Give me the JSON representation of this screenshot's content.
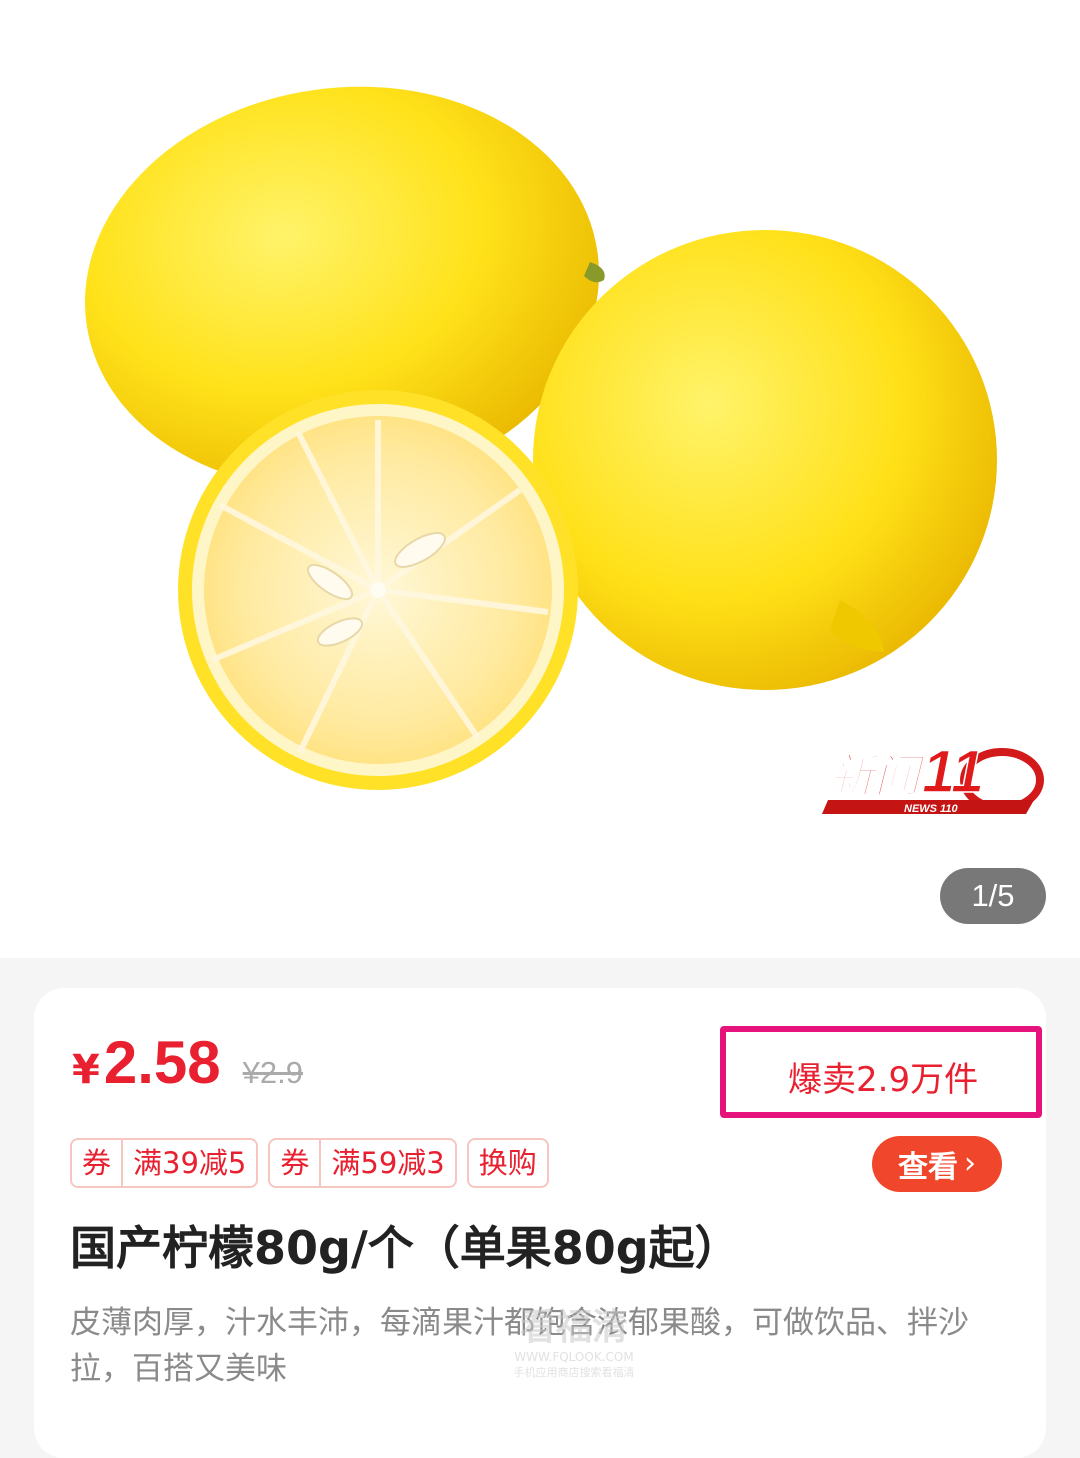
{
  "gallery": {
    "pager": "1/5",
    "logo": {
      "brand": "新闻110",
      "sub": "NEWS 110"
    }
  },
  "product": {
    "currency": "¥",
    "price": "2.58",
    "original_price": "¥2.9",
    "sold": "爆卖2.9万件",
    "tags": [
      {
        "segments": [
          "券",
          "满39减5"
        ]
      },
      {
        "segments": [
          "券",
          "满59减3"
        ]
      },
      {
        "segments": [
          "换购"
        ]
      }
    ],
    "view_button": "查看",
    "title": "国产柠檬80g/个（单果80g起）",
    "description": "皮薄肉厚，汁水丰沛，每滴果汁都饱含浓郁果酸，可做饮品、拌沙拉，百搭又美味"
  },
  "watermark": {
    "line1": "看福清",
    "line2": "WWW.FQLOOK.COM",
    "line3": "手机应用商店搜索看福清"
  },
  "colors": {
    "accent_red": "#e8202f",
    "highlight_box": "#e6137d",
    "button_orange": "#f0462c"
  }
}
